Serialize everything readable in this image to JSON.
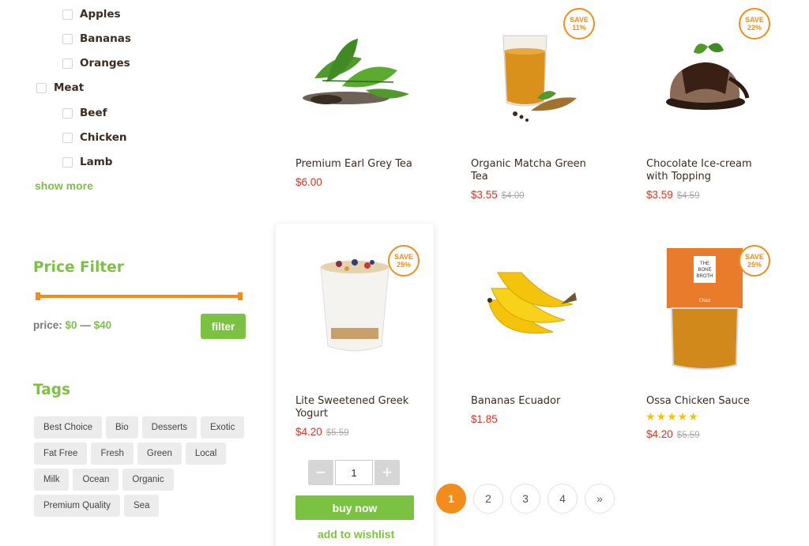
{
  "sidebar": {
    "categories": [
      {
        "label": "Apples"
      },
      {
        "label": "Bananas"
      },
      {
        "label": "Oranges"
      },
      {
        "label": "Meat"
      },
      {
        "label": "Beef"
      },
      {
        "label": "Chicken"
      },
      {
        "label": "Lamb"
      }
    ],
    "show_more": "show more",
    "price_filter": {
      "title": "Price Filter",
      "label": "price:",
      "min": "$0",
      "dash": "—",
      "max": "$40",
      "button": "filter"
    },
    "tags": {
      "title": "Tags",
      "items": [
        "Best Choice",
        "Bio",
        "Desserts",
        "Exotic",
        "Fat Free",
        "Fresh",
        "Green",
        "Local",
        "Milk",
        "Ocean",
        "Organic",
        "Premium Quality",
        "Sea"
      ]
    }
  },
  "products": [
    {
      "name": "Premium Earl Grey Tea",
      "price": "$6.00",
      "old_price": "",
      "badge": ""
    },
    {
      "name": "Organic Matcha Green Tea",
      "price": "$3.55",
      "old_price": "$4.00",
      "badge": "SAVE 11%"
    },
    {
      "name": "Chocolate Ice-cream with Topping",
      "price": "$3.59",
      "old_price": "$4.59",
      "badge": "SAVE 22%"
    },
    {
      "name": "Lite Sweetened Greek Yogurt",
      "price": "$4.20",
      "old_price": "$5.59",
      "badge": "SAVE 25%",
      "quantity": "1",
      "buy_label": "buy now",
      "wishlist_label": "add to wishlist"
    },
    {
      "name": "Bananas Ecuador",
      "price": "$1.85",
      "old_price": "",
      "badge": ""
    },
    {
      "name": "Ossa Chicken Sauce",
      "price": "$4.20",
      "old_price": "$5.59",
      "badge": "SAVE 25%",
      "stars": "★★★★★",
      "rating": 5,
      "package_text": {
        "line1": "THE",
        "line2": "BONE",
        "line3": "BROTH",
        "brand": "Ossa"
      }
    }
  ],
  "badges": {
    "save": "SAVE",
    "p1": "11%",
    "p2": "22%",
    "p3": "25%",
    "p5": "25%"
  },
  "qty_controls": {
    "minus": "−",
    "plus": "+"
  },
  "pagination": {
    "pages": [
      "1",
      "2",
      "3",
      "4"
    ],
    "current": "1",
    "next": "»"
  },
  "colors": {
    "accent_green": "#7cc242",
    "accent_orange": "#f28c1a",
    "price_red": "#e4301b"
  }
}
